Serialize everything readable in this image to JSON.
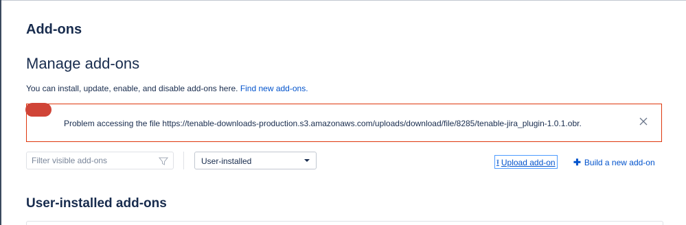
{
  "page": {
    "title": "Add-ons"
  },
  "manage": {
    "title": "Manage add-ons",
    "intro_text": "You can install, update, enable, and disable add-ons here.",
    "find_link": "Find new add-ons."
  },
  "error": {
    "message": "Problem accessing the file https://tenable-downloads-production.s3.amazonaws.com/uploads/download/file/8285/tenable-jira_plugin-1.0.1.obr."
  },
  "toolbar": {
    "filter_placeholder": "Filter visible add-ons",
    "filter_value": "",
    "select_value": "User-installed",
    "upload_label": "Upload add-on",
    "build_label": "Build a new add-on"
  },
  "list": {
    "title": "User-installed add-ons"
  },
  "icons": {
    "error_pill": "error-indicator",
    "close": "close-icon",
    "filter": "filter-icon",
    "caret": "chevron-down-icon",
    "upload": "upload-icon",
    "plus": "plus-icon"
  },
  "colors": {
    "error_border": "#de350b",
    "error_pill": "#d04437",
    "link": "#0052cc",
    "text": "#172b4d"
  }
}
